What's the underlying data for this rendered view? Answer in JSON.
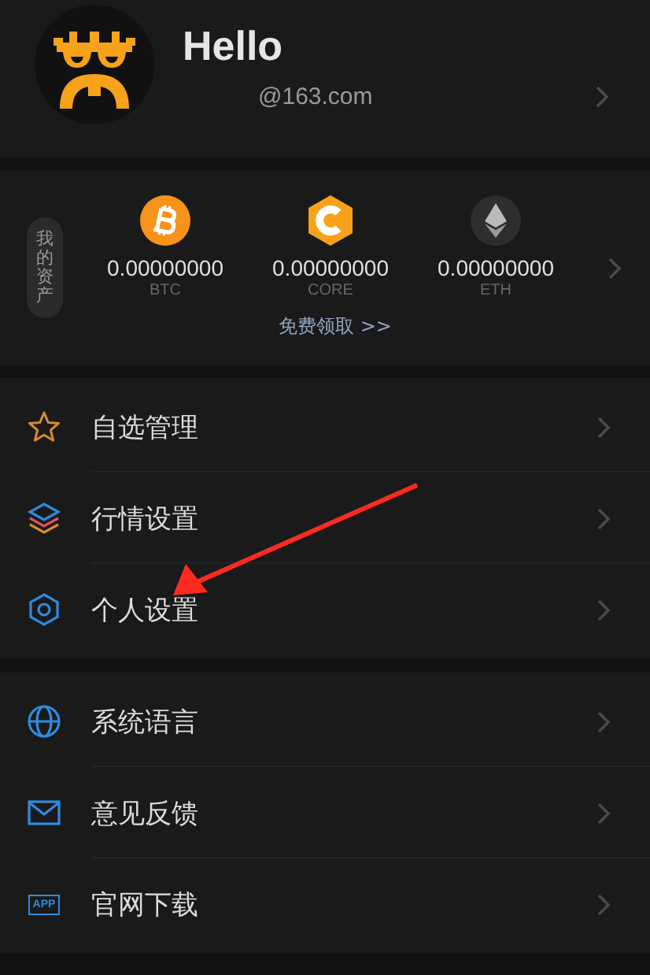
{
  "profile": {
    "name": "Hello",
    "email": "@163.com"
  },
  "assets": {
    "label": "我的资产",
    "coins": [
      {
        "kind": "btc",
        "amount": "0.00000000",
        "symbol": "BTC"
      },
      {
        "kind": "core",
        "amount": "0.00000000",
        "symbol": "CORE"
      },
      {
        "kind": "eth",
        "amount": "0.00000000",
        "symbol": "ETH"
      }
    ],
    "claim_link": "免费领取 >>"
  },
  "menu_groups": [
    [
      {
        "kind": "star",
        "label": "自选管理"
      },
      {
        "kind": "layers",
        "label": "行情设置"
      },
      {
        "kind": "hexagon",
        "label": "个人设置"
      }
    ],
    [
      {
        "kind": "globe",
        "label": "系统语言"
      },
      {
        "kind": "mail",
        "label": "意见反馈"
      },
      {
        "kind": "app",
        "label": "官网下载",
        "icon_text": "APP"
      }
    ]
  ]
}
